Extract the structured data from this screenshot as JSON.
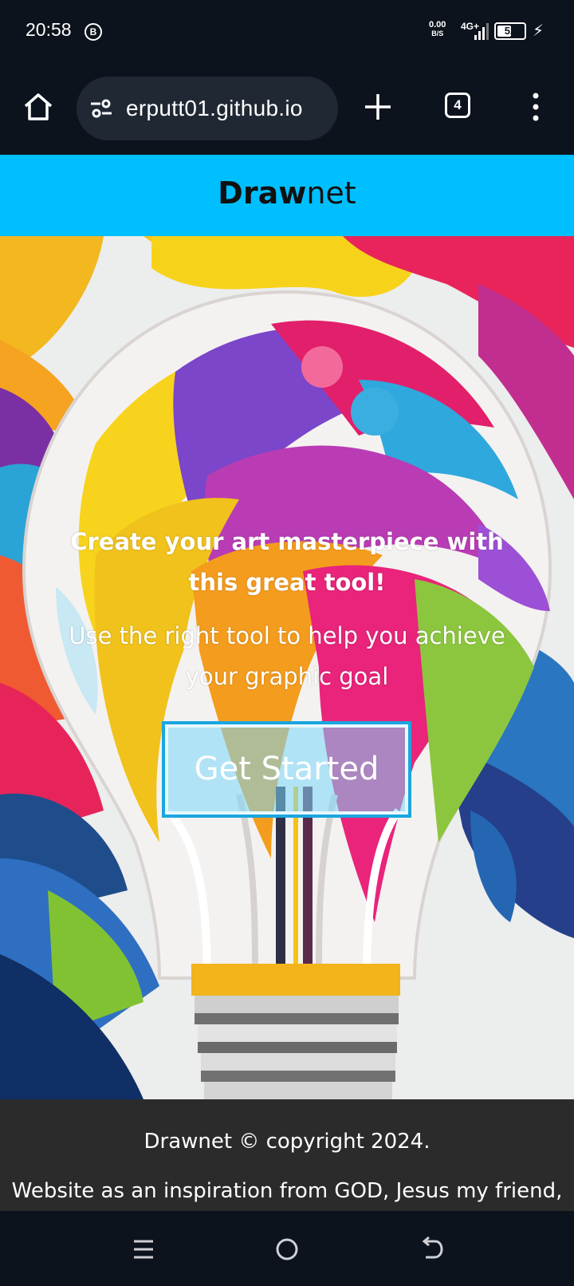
{
  "status_bar": {
    "time": "20:58",
    "notification_badge": "B",
    "net_speed_value": "0.00",
    "net_speed_unit": "B/S",
    "network": "4G+",
    "battery_level": 52,
    "battery_text": "52"
  },
  "browser": {
    "url": "erputt01.github.io",
    "tab_count": "4"
  },
  "site": {
    "brand_bold": "Draw",
    "brand_light": "net",
    "header_color": "#00bfff"
  },
  "hero": {
    "title": "Create your art masterpiece with this great tool!",
    "subtitle": "Use the right tool to help you achieve your graphic goal",
    "cta_label": "Get Started"
  },
  "footer": {
    "copyright": "Drawnet © copyright 2024.",
    "note": "Website as an inspiration from GOD, Jesus my friend,"
  },
  "icons": {
    "home": "home-icon",
    "site_settings": "tune-icon",
    "new_tab": "plus-icon",
    "tabs": "tab-switcher-icon",
    "menu": "more-vert-icon",
    "nav_recents": "menu-lines-icon",
    "nav_home": "circle-icon",
    "nav_back": "back-icon"
  }
}
